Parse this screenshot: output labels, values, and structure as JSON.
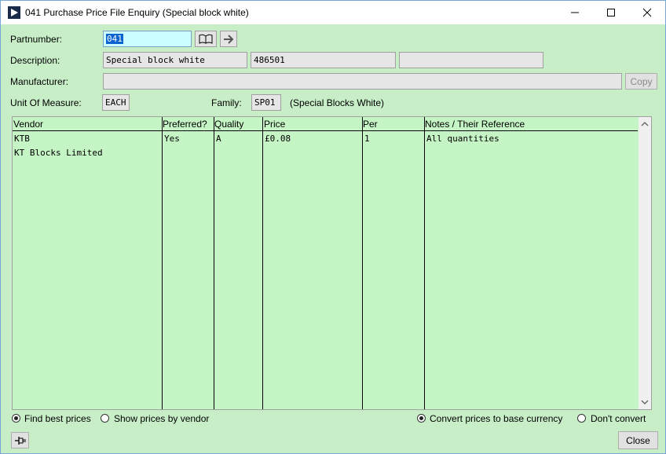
{
  "window": {
    "title": "041 Purchase Price File Enquiry (Special block white)"
  },
  "form": {
    "partnumber_label": "Partnumber:",
    "partnumber_value": "041",
    "description_label": "Description:",
    "description_1": "Special block white",
    "description_2": "486501",
    "description_3": "",
    "manufacturer_label": "Manufacturer:",
    "manufacturer_value": "",
    "copy_label": "Copy",
    "uom_label": "Unit Of Measure:",
    "uom_value": "EACH",
    "family_label": "Family:",
    "family_value": "SP01",
    "family_desc": "(Special Blocks White)"
  },
  "grid": {
    "headers": [
      "Vendor",
      "Preferred?",
      "Quality",
      "Price",
      "Per",
      "Notes / Their Reference"
    ],
    "rows": [
      {
        "vendor_code": "KTB",
        "vendor_name": "KT Blocks Limited",
        "preferred": "Yes",
        "quality": "A",
        "price": "£0.08",
        "per": "1",
        "notes": "All quantities"
      }
    ]
  },
  "options": {
    "find_best": "Find best prices",
    "by_vendor": "Show prices by vendor",
    "convert": "Convert prices to base currency",
    "dont_convert": "Don't convert",
    "find_best_selected": true,
    "convert_selected": true
  },
  "footer": {
    "close_label": "Close"
  },
  "icons": {
    "app": "play-icon",
    "lookup": "book-icon",
    "next": "arrow-right-icon",
    "pin": "pin-icon"
  }
}
